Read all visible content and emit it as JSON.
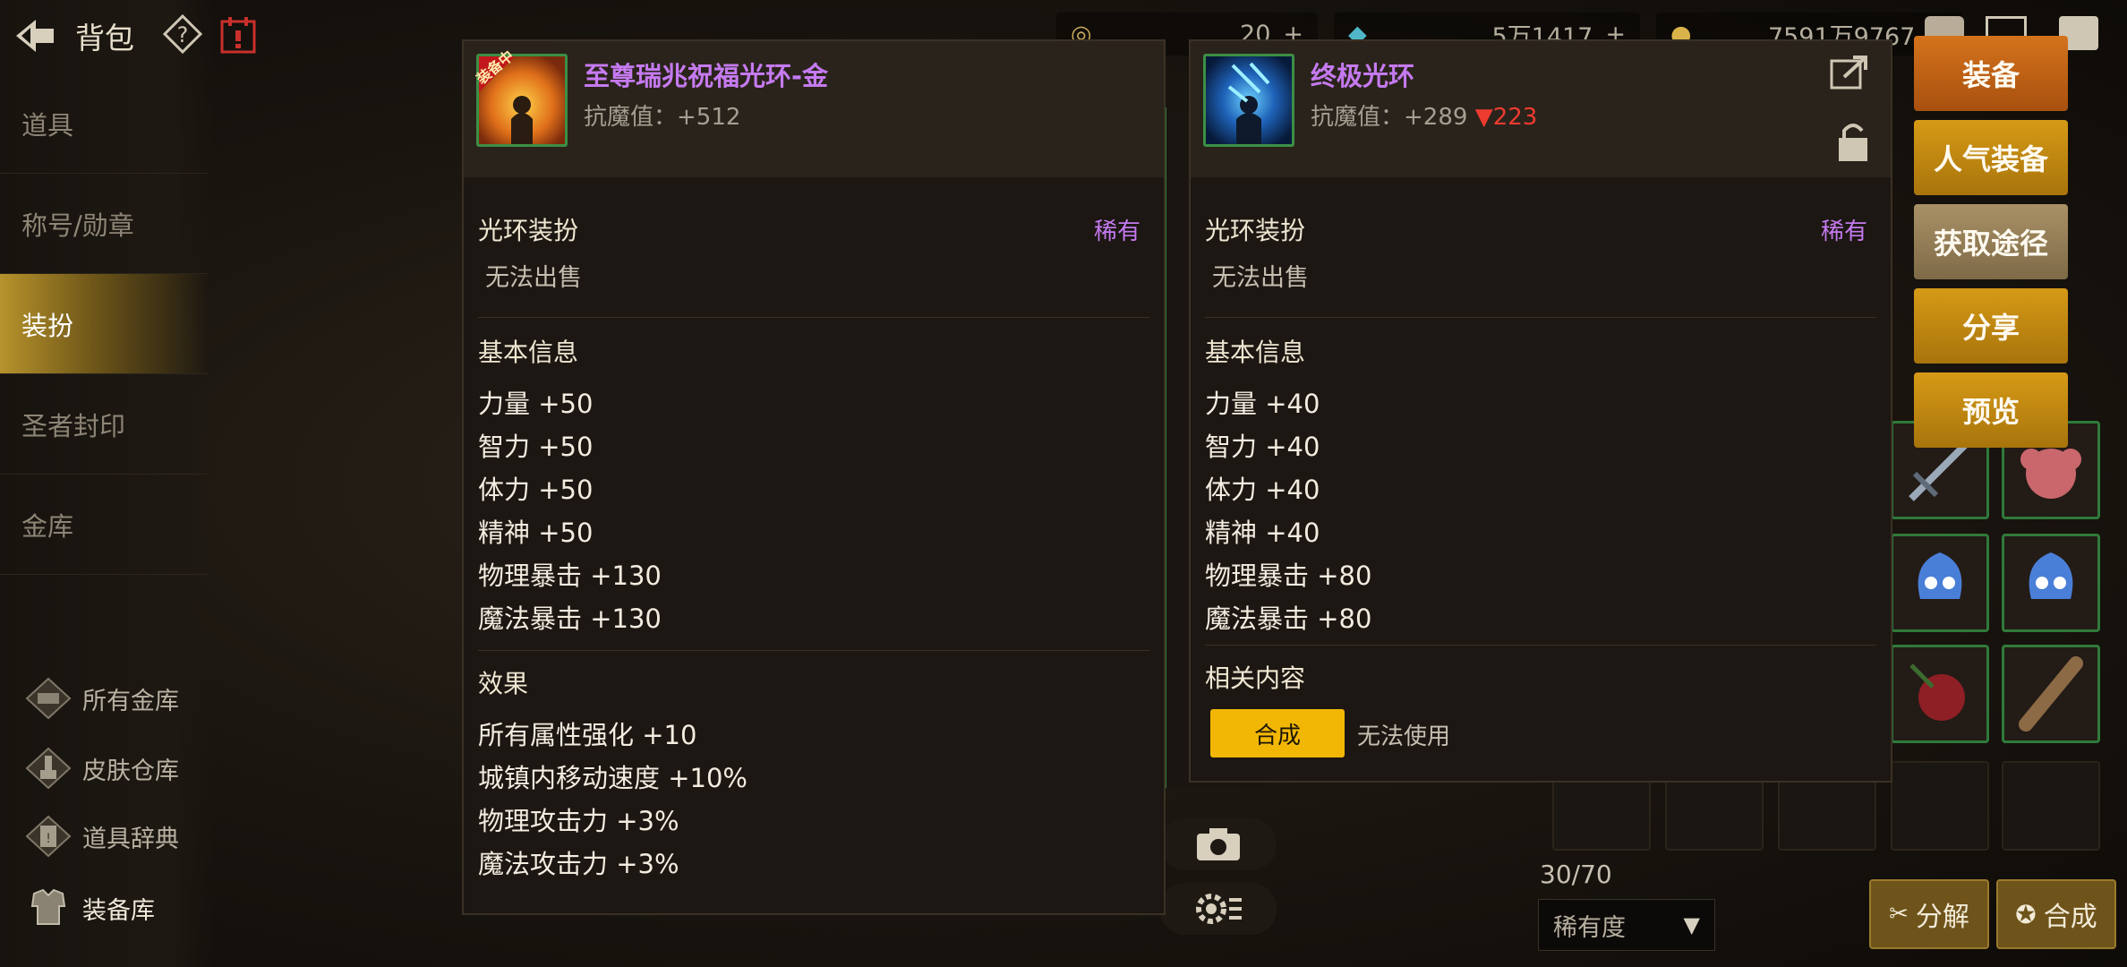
{
  "header": {
    "title": "背包"
  },
  "sidebar": {
    "nav": [
      {
        "label": "道具"
      },
      {
        "label": "称号/勋章"
      },
      {
        "label": "装扮"
      },
      {
        "label": "圣者封印"
      },
      {
        "label": "金库"
      }
    ],
    "links": [
      {
        "label": "所有金库",
        "icon": "vault-icon"
      },
      {
        "label": "皮肤仓库",
        "icon": "brush-icon"
      },
      {
        "label": "道具辞典",
        "icon": "book-icon"
      },
      {
        "label": "装备库",
        "icon": "armor-icon"
      }
    ]
  },
  "topbar": {
    "r1": "20",
    "r2": "5万1417",
    "r3": "7591万9767"
  },
  "left_panel": {
    "name": "至尊瑞兆祝福光环-金",
    "stat_label": "抗魔值：",
    "stat_value": "+512",
    "category": "光环装扮",
    "rarity": "稀有",
    "trade": "无法出售",
    "basic_title": "基本信息",
    "basic": [
      "力量 +50",
      "智力 +50",
      "体力 +50",
      "精神 +50",
      "物理暴击 +130",
      "魔法暴击 +130"
    ],
    "effect_title": "效果",
    "effects": [
      "所有属性强化 +10",
      "城镇内移动速度 +10%",
      "物理攻击力 +3%",
      "魔法攻击力 +3%"
    ],
    "badge": "装备中"
  },
  "right_panel": {
    "name": "终极光环",
    "stat_label": "抗魔值：",
    "stat_value": "+289",
    "stat_diff": "▼223",
    "category": "光环装扮",
    "rarity": "稀有",
    "trade": "无法出售",
    "basic_title": "基本信息",
    "basic": [
      "力量 +40",
      "智力 +40",
      "体力 +40",
      "精神 +40",
      "物理暴击 +80",
      "魔法暴击 +80"
    ],
    "related_title": "相关内容",
    "craft_button": "合成",
    "usage": "无法使用"
  },
  "actions": [
    "装备",
    "人气装备",
    "获取途径",
    "分享",
    "预览"
  ],
  "inventory": {
    "count": "30/70",
    "sort_label": "稀有度",
    "decompose": "分解",
    "synthesize": "合成"
  },
  "colors": {
    "rare_purple": "#c57af0",
    "down_red": "#ee3b2f",
    "active_gold": "#b7932c"
  }
}
